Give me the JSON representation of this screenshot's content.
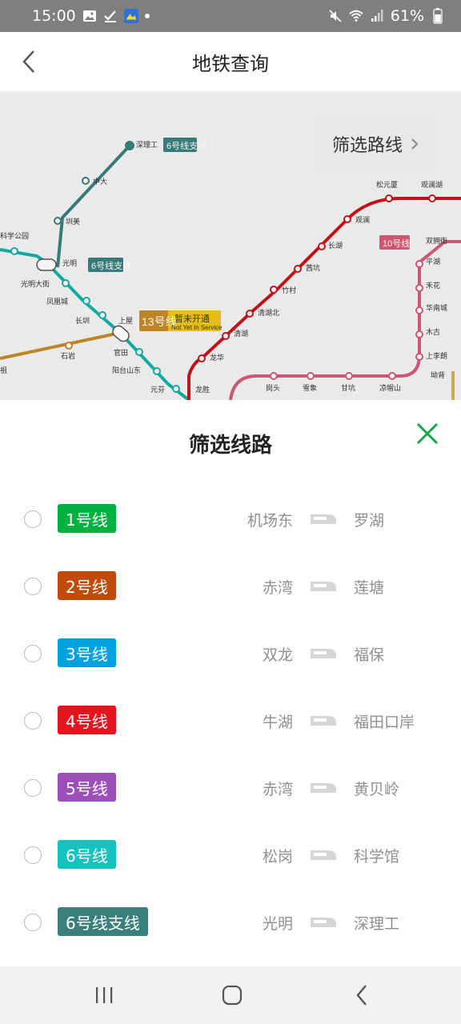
{
  "status_bar": {
    "time": "15:00",
    "battery": "61%"
  },
  "header": {
    "title": "地铁查询"
  },
  "map": {
    "filter_button_label": "筛选路线",
    "stations": [
      "深理工",
      "中大",
      "圳美",
      "光明",
      "科学公园",
      "光明大街",
      "凤凰城",
      "长圳",
      "上屋",
      "官田",
      "阳台山东",
      "元芬",
      "石岩",
      "龙华",
      "清湖",
      "清湖北",
      "竹村",
      "茜坑",
      "长湖",
      "观澜",
      "松元厦",
      "观澜湖",
      "双拥街",
      "平湖",
      "禾花",
      "华南城",
      "木古",
      "上李朗",
      "坳背",
      "岗头",
      "雪象",
      "甘坑",
      "凉帽山",
      "龙胜"
    ],
    "line_labels": [
      "6号线支线",
      "6号线支线",
      "13号线",
      "暂未开通",
      "Not Yet In Service",
      "10号线"
    ]
  },
  "sheet": {
    "title": "筛选线路",
    "lines": [
      {
        "name": "1号线",
        "from": "机场东",
        "to": "罗湖",
        "color": "#00b140"
      },
      {
        "name": "2号线",
        "from": "赤湾",
        "to": "莲塘",
        "color": "#c04b0a"
      },
      {
        "name": "3号线",
        "from": "双龙",
        "to": "福保",
        "color": "#00a3e0"
      },
      {
        "name": "4号线",
        "from": "牛湖",
        "to": "福田口岸",
        "color": "#e4151f"
      },
      {
        "name": "5号线",
        "from": "赤湾",
        "to": "黄贝岭",
        "color": "#9b4fb8"
      },
      {
        "name": "6号线",
        "from": "松岗",
        "to": "科学馆",
        "color": "#14c3bd"
      },
      {
        "name": "6号线支线",
        "from": "光明",
        "to": "深理工",
        "color": "#3a7f7c"
      }
    ]
  }
}
